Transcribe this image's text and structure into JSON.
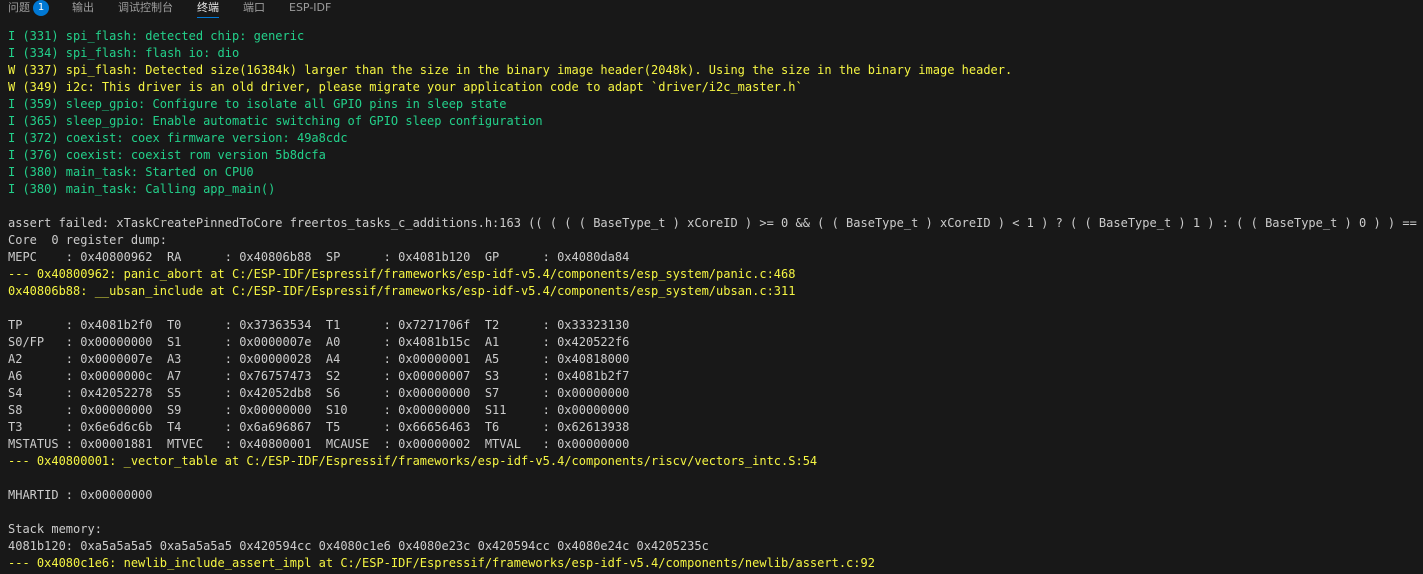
{
  "tabs": [
    {
      "label": "问题",
      "badge": "1",
      "active": false
    },
    {
      "label": "输出",
      "active": false
    },
    {
      "label": "调试控制台",
      "active": false
    },
    {
      "label": "终端",
      "active": true
    },
    {
      "label": "端口",
      "active": false
    },
    {
      "label": "ESP-IDF",
      "active": false
    }
  ],
  "colors": {
    "background": "#181818",
    "info": "#23d18b",
    "warning": "#f5f543",
    "normal": "#cccccc",
    "accent": "#0078d4"
  },
  "terminal": {
    "lines": [
      {
        "text": "I (331) spi_flash: detected chip: generic",
        "level": "info"
      },
      {
        "text": "I (334) spi_flash: flash io: dio",
        "level": "info"
      },
      {
        "text": "W (337) spi_flash: Detected size(16384k) larger than the size in the binary image header(2048k). Using the size in the binary image header.",
        "level": "warn"
      },
      {
        "text": "W (349) i2c: This driver is an old driver, please migrate your application code to adapt `driver/i2c_master.h`",
        "level": "warn"
      },
      {
        "text": "I (359) sleep_gpio: Configure to isolate all GPIO pins in sleep state",
        "level": "info"
      },
      {
        "text": "I (365) sleep_gpio: Enable automatic switching of GPIO sleep configuration",
        "level": "info"
      },
      {
        "text": "I (372) coexist: coex firmware version: 49a8cdc",
        "level": "info"
      },
      {
        "text": "I (376) coexist: coexist rom version 5b8dcfa",
        "level": "info"
      },
      {
        "text": "I (380) main_task: Started on CPU0",
        "level": "info"
      },
      {
        "text": "I (380) main_task: Calling app_main()",
        "level": "info"
      },
      {
        "text": "",
        "level": "norm"
      },
      {
        "text": "assert failed: xTaskCreatePinnedToCore freertos_tasks_c_additions.h:163 (( ( ( ( BaseType_t ) xCoreID ) >= 0 && ( ( BaseType_t ) xCoreID ) < 1 ) ? ( ( BaseType_t ) 1 ) : ( ( BaseType_t ) 0 ) ) == ( (",
        "level": "norm"
      },
      {
        "text": "Core  0 register dump:",
        "level": "norm"
      },
      {
        "text": "MEPC    : 0x40800962  RA      : 0x40806b88  SP      : 0x4081b120  GP      : 0x4080da84",
        "level": "norm"
      },
      {
        "text": "--- 0x40800962: panic_abort at C:/ESP-IDF/Espressif/frameworks/esp-idf-v5.4/components/esp_system/panic.c:468",
        "level": "warn"
      },
      {
        "text": "0x40806b88: __ubsan_include at C:/ESP-IDF/Espressif/frameworks/esp-idf-v5.4/components/esp_system/ubsan.c:311",
        "level": "warn"
      },
      {
        "text": "",
        "level": "norm"
      },
      {
        "text": "TP      : 0x4081b2f0  T0      : 0x37363534  T1      : 0x7271706f  T2      : 0x33323130",
        "level": "norm"
      },
      {
        "text": "S0/FP   : 0x00000000  S1      : 0x0000007e  A0      : 0x4081b15c  A1      : 0x420522f6",
        "level": "norm"
      },
      {
        "text": "A2      : 0x0000007e  A3      : 0x00000028  A4      : 0x00000001  A5      : 0x40818000",
        "level": "norm"
      },
      {
        "text": "A6      : 0x0000000c  A7      : 0x76757473  S2      : 0x00000007  S3      : 0x4081b2f7",
        "level": "norm"
      },
      {
        "text": "S4      : 0x42052278  S5      : 0x42052db8  S6      : 0x00000000  S7      : 0x00000000",
        "level": "norm"
      },
      {
        "text": "S8      : 0x00000000  S9      : 0x00000000  S10     : 0x00000000  S11     : 0x00000000",
        "level": "norm"
      },
      {
        "text": "T3      : 0x6e6d6c6b  T4      : 0x6a696867  T5      : 0x66656463  T6      : 0x62613938",
        "level": "norm"
      },
      {
        "text": "MSTATUS : 0x00001881  MTVEC   : 0x40800001  MCAUSE  : 0x00000002  MTVAL   : 0x00000000",
        "level": "norm"
      },
      {
        "text": "--- 0x40800001: _vector_table at C:/ESP-IDF/Espressif/frameworks/esp-idf-v5.4/components/riscv/vectors_intc.S:54",
        "level": "warn"
      },
      {
        "text": "",
        "level": "norm"
      },
      {
        "text": "MHARTID : 0x00000000",
        "level": "norm"
      },
      {
        "text": "",
        "level": "norm"
      },
      {
        "text": "Stack memory:",
        "level": "norm"
      },
      {
        "text": "4081b120: 0xa5a5a5a5 0xa5a5a5a5 0x420594cc 0x4080c1e6 0x4080e23c 0x420594cc 0x4080e24c 0x4205235c",
        "level": "norm"
      },
      {
        "text": "--- 0x4080c1e6: newlib_include_assert_impl at C:/ESP-IDF/Espressif/frameworks/esp-idf-v5.4/components/newlib/assert.c:92",
        "level": "warn"
      }
    ]
  }
}
